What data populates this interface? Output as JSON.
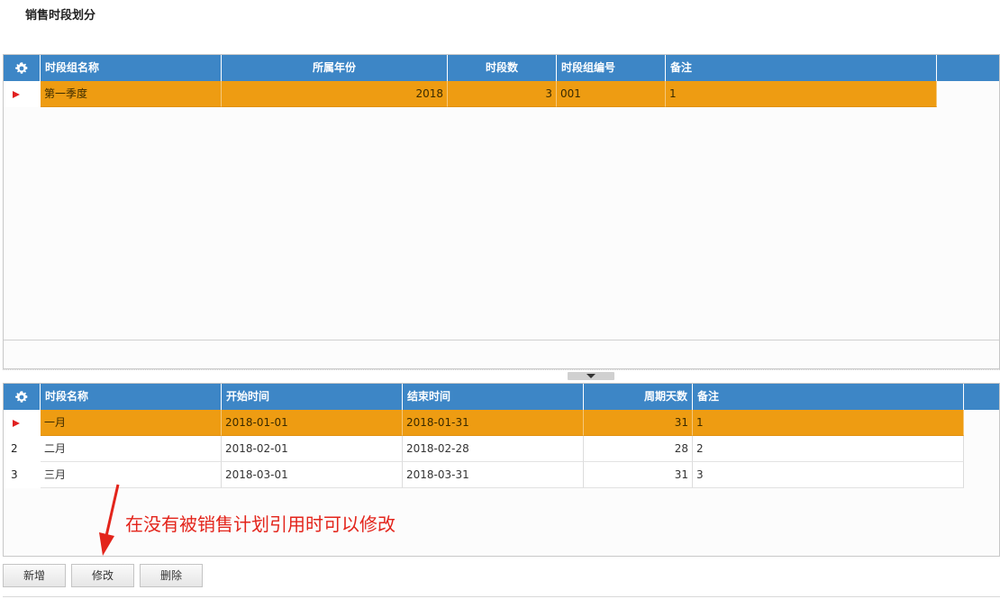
{
  "page": {
    "title": "销售时段划分"
  },
  "top_grid": {
    "columns": [
      "时段组名称",
      "所属年份",
      "时段数",
      "时段组编号",
      "备注"
    ],
    "rows": [
      {
        "name": "第一季度",
        "year": "2018",
        "count": "3",
        "code": "001",
        "remark": "1"
      }
    ]
  },
  "bottom_grid": {
    "columns": [
      "时段名称",
      "开始时间",
      "结束时间",
      "周期天数",
      "备注"
    ],
    "rows": [
      {
        "index": "",
        "name": "一月",
        "start": "2018-01-01",
        "end": "2018-01-31",
        "days": "31",
        "remark": "1"
      },
      {
        "index": "2",
        "name": "二月",
        "start": "2018-02-01",
        "end": "2018-02-28",
        "days": "28",
        "remark": "2"
      },
      {
        "index": "3",
        "name": "三月",
        "start": "2018-03-01",
        "end": "2018-03-31",
        "days": "31",
        "remark": "3"
      }
    ]
  },
  "buttons": {
    "add": "新增",
    "edit": "修改",
    "delete": "删除"
  },
  "annotation": {
    "text": "在没有被销售计划引用时可以修改"
  },
  "colors": {
    "header": "#3d86c6",
    "selected_row": "#ee9c12",
    "annotation": "#e3241b"
  }
}
